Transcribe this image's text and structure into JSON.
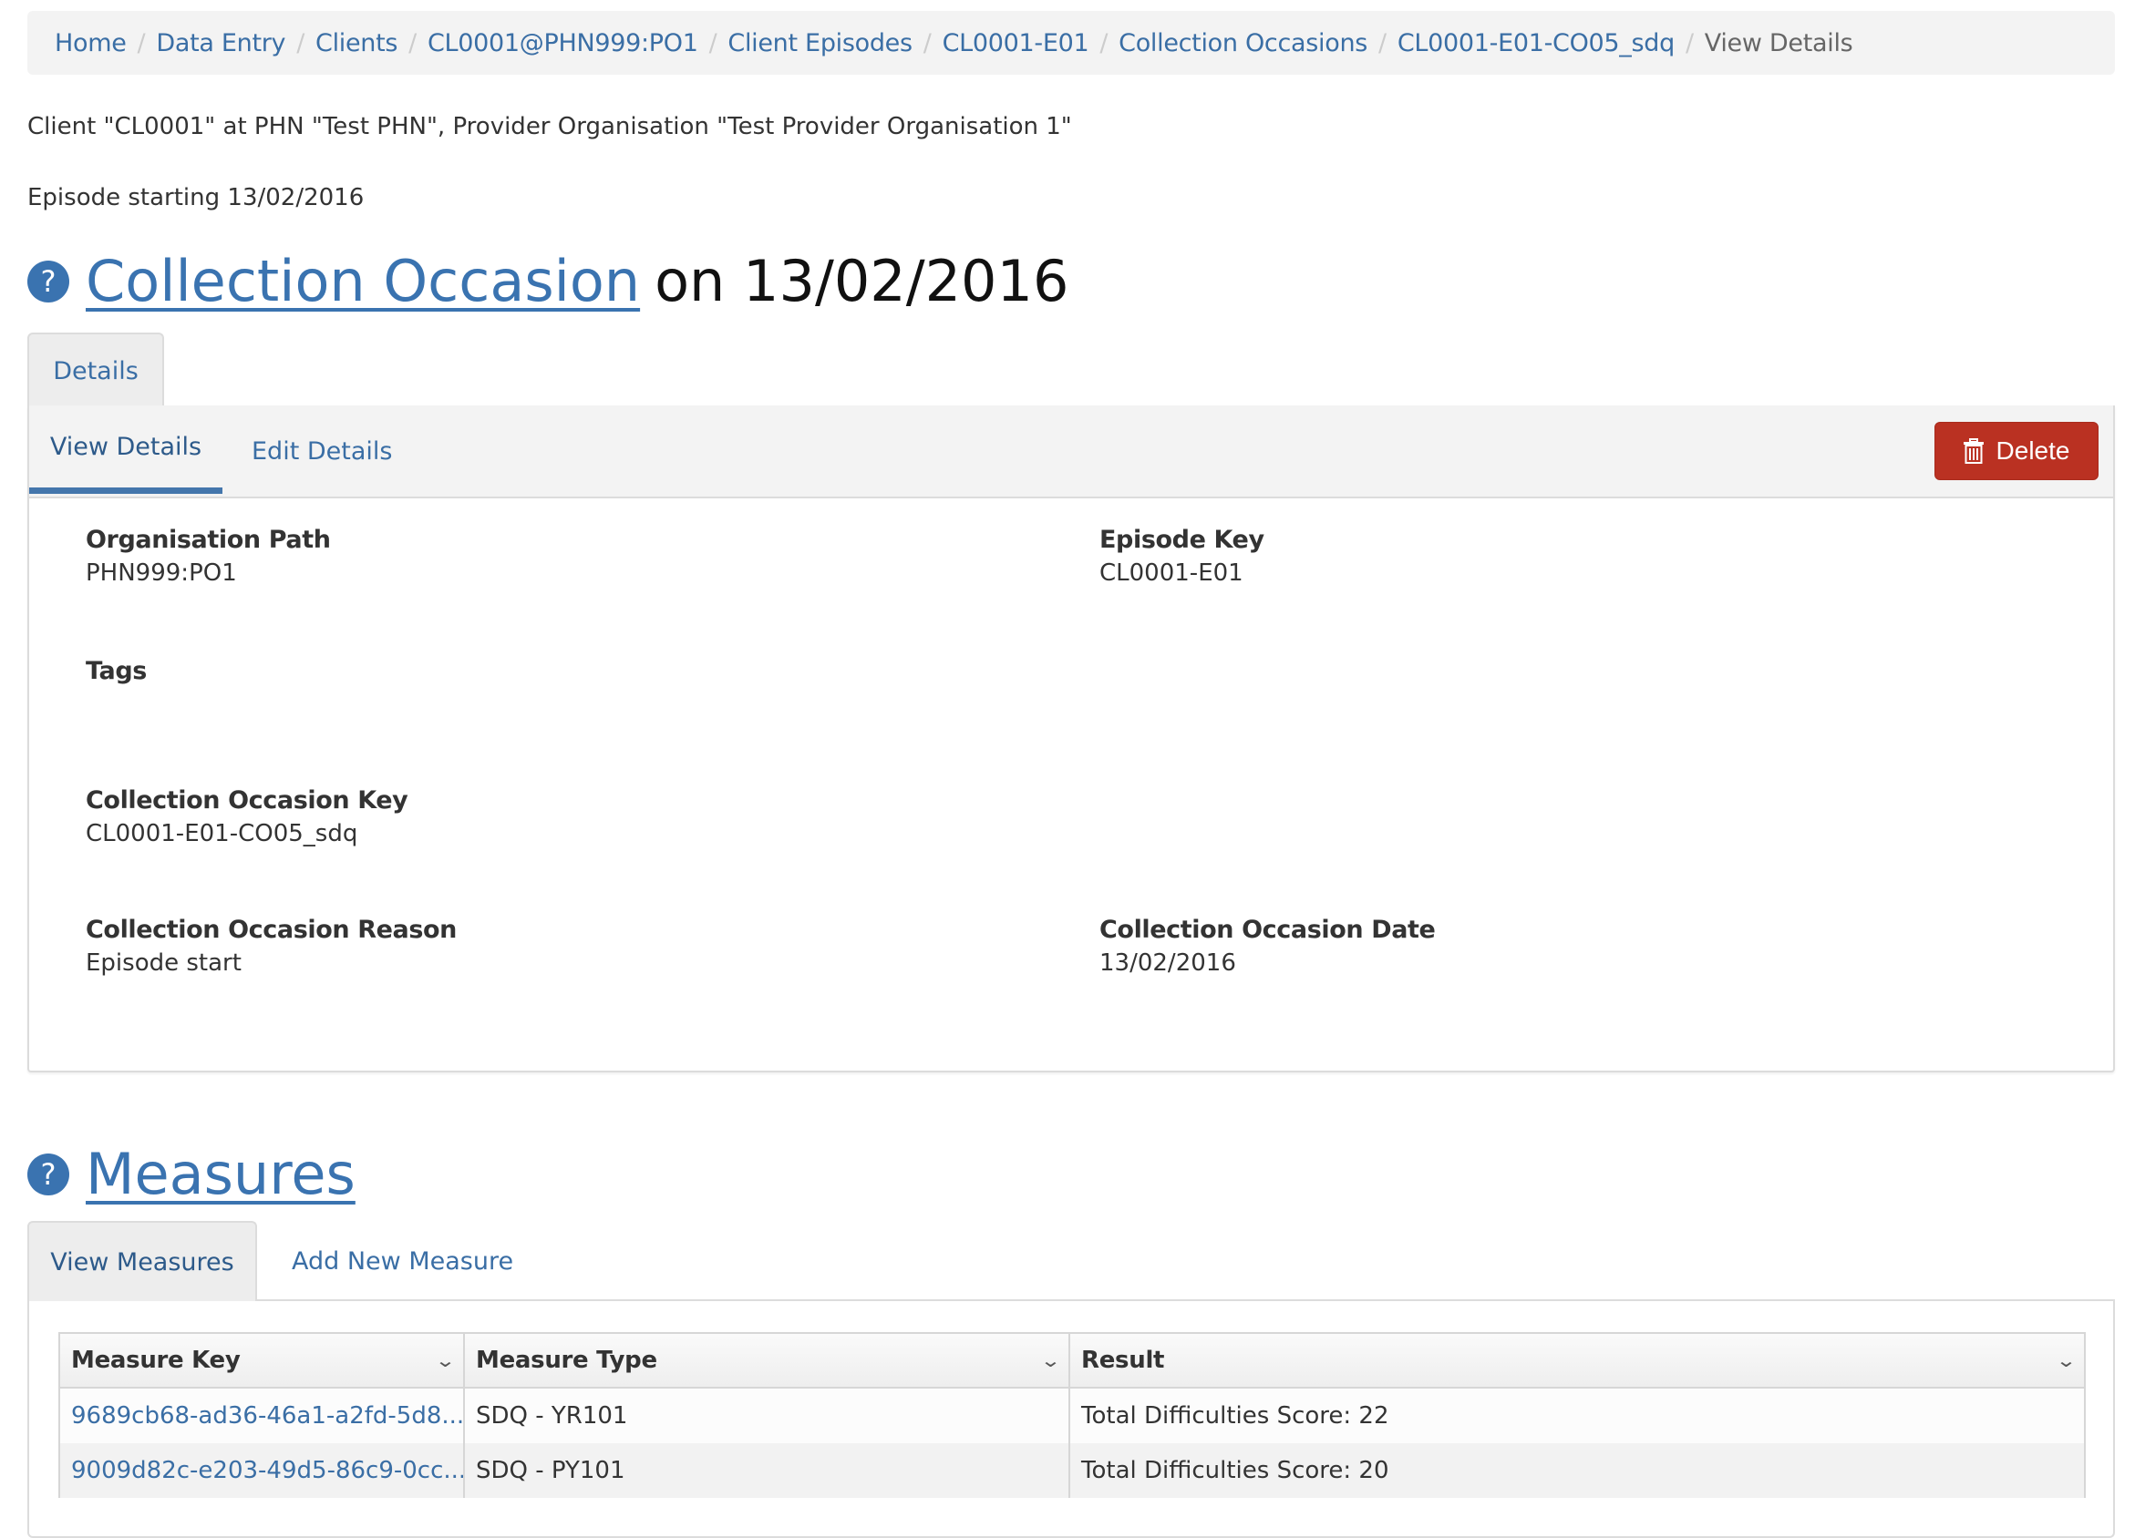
{
  "breadcrumb": [
    {
      "label": "Home",
      "active": false
    },
    {
      "label": "Data Entry",
      "active": false
    },
    {
      "label": "Clients",
      "active": false
    },
    {
      "label": "CL0001@PHN999:PO1",
      "active": false
    },
    {
      "label": "Client Episodes",
      "active": false
    },
    {
      "label": "CL0001-E01",
      "active": false
    },
    {
      "label": "Collection Occasions",
      "active": false
    },
    {
      "label": "CL0001-E01-CO05_sdq",
      "active": false
    },
    {
      "label": "View Details",
      "active": true
    }
  ],
  "breadcrumb_separator": "/",
  "client_info": "Client \"CL0001\" at PHN \"Test PHN\", Provider Organisation \"Test Provider Organisation 1\"",
  "episode_info": "Episode starting 13/02/2016",
  "collection_occasion": {
    "help_icon": "?",
    "title_link": "Collection Occasion",
    "title_suffix": "on 13/02/2016",
    "tab": "Details",
    "subtabs": {
      "view": "View Details",
      "edit": "Edit Details"
    },
    "delete_label": "Delete",
    "fields": {
      "organisation_path": {
        "label": "Organisation Path",
        "value": "PHN999:PO1"
      },
      "episode_key": {
        "label": "Episode Key",
        "value": "CL0001-E01"
      },
      "tags": {
        "label": "Tags",
        "value": ""
      },
      "collection_occasion_key": {
        "label": "Collection Occasion Key",
        "value": "CL0001-E01-CO05_sdq"
      },
      "collection_occasion_reason": {
        "label": "Collection Occasion Reason",
        "value": "Episode start"
      },
      "collection_occasion_date": {
        "label": "Collection Occasion Date",
        "value": "13/02/2016"
      }
    }
  },
  "measures": {
    "help_icon": "?",
    "title_link": "Measures",
    "tabs": {
      "view": "View Measures",
      "add": "Add New Measure"
    },
    "columns": [
      "Measure Key",
      "Measure Type",
      "Result"
    ],
    "sort_icon": "⌄",
    "rows": [
      {
        "key": "9689cb68-ad36-46a1-a2fd-5d8...",
        "type": "SDQ - YR101",
        "result": "Total Difficulties Score: 22"
      },
      {
        "key": "9009d82c-e203-49d5-86c9-0cc...",
        "type": "SDQ - PY101",
        "result": "Total Difficulties Score: 20"
      }
    ]
  },
  "colors": {
    "link": "#3a6ea5",
    "help_icon_bg": "#3a73b0",
    "delete_bg": "#ba3122",
    "active_tab_underline": "#4476ac"
  }
}
